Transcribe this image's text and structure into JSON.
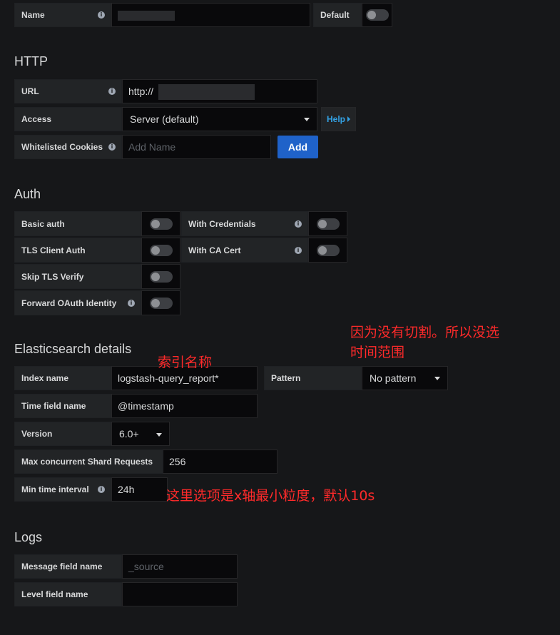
{
  "top": {
    "name_label": "Name",
    "name_value": "",
    "default_label": "Default"
  },
  "http": {
    "section_title": "HTTP",
    "url_label": "URL",
    "url_value": "http://",
    "access_label": "Access",
    "access_value": "Server (default)",
    "help_label": "Help",
    "cookies_label": "Whitelisted Cookies",
    "cookies_placeholder": "Add Name",
    "add_label": "Add"
  },
  "auth": {
    "section_title": "Auth",
    "basic_auth": "Basic auth",
    "with_credentials": "With Credentials",
    "tls_client_auth": "TLS Client Auth",
    "with_ca_cert": "With CA Cert",
    "skip_tls_verify": "Skip TLS Verify",
    "forward_oauth": "Forward OAuth Identity"
  },
  "es": {
    "section_title": "Elasticsearch details",
    "index_label": "Index name",
    "index_value": "logstash-query_report*",
    "pattern_label": "Pattern",
    "pattern_value": "No pattern",
    "time_field_label": "Time field name",
    "time_field_value": "@timestamp",
    "version_label": "Version",
    "version_value": "6.0+",
    "shard_label": "Max concurrent Shard Requests",
    "shard_value": "256",
    "min_interval_label": "Min time interval",
    "min_interval_value": "24h"
  },
  "logs": {
    "section_title": "Logs",
    "message_label": "Message field name",
    "message_placeholder": "_source",
    "level_label": "Level field name",
    "level_value": ""
  },
  "annotations": {
    "index_note": "索引名称",
    "pattern_note_line1": "因为没有切割。所以没选",
    "pattern_note_line2": "时间范围",
    "interval_note": "这里选项是x轴最小粒度，默认10s"
  },
  "colors": {
    "background": "#161719",
    "accent_blue": "#1f62c9",
    "annotation_red": "#ff2a2a"
  }
}
